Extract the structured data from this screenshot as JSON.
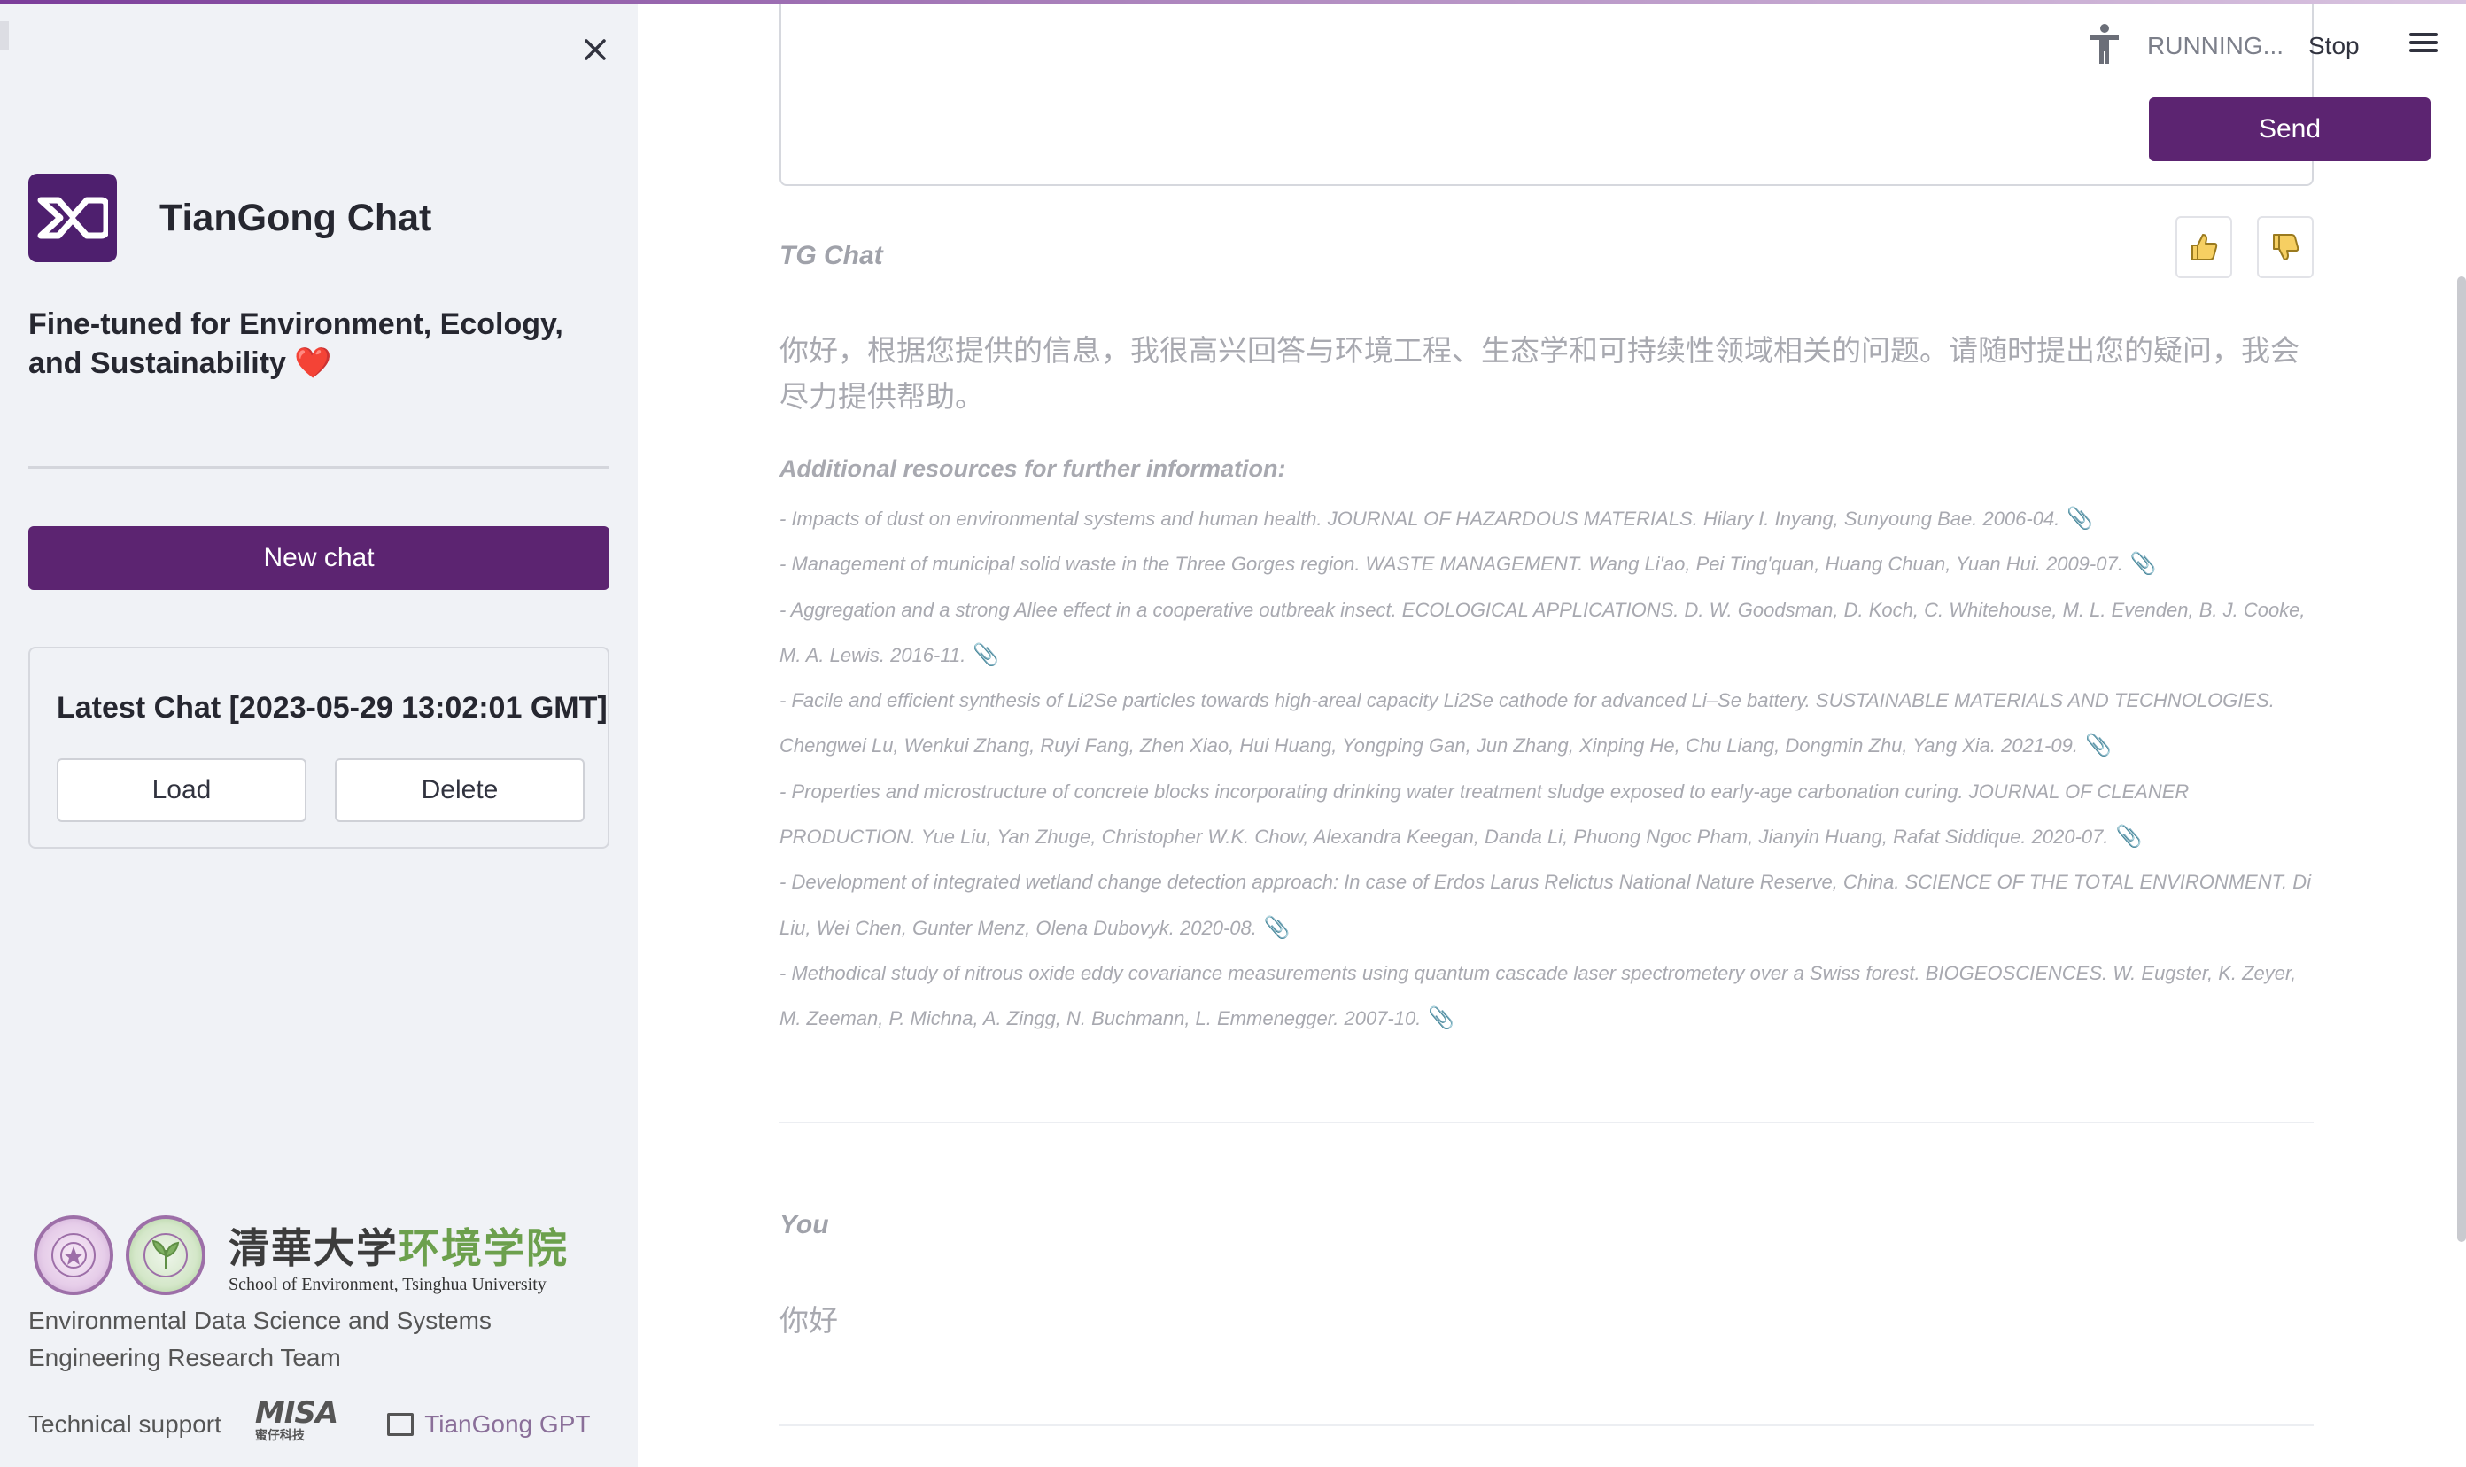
{
  "sidebar": {
    "brand_title": "TianGong Chat",
    "tagline": "Fine-tuned for Environment, Ecology, and Sustainability",
    "tagline_emoji": "❤️",
    "new_chat_label": "New chat",
    "latest_chat": {
      "title": "Latest Chat [2023-05-29 13:02:01 GMT]",
      "load_label": "Load",
      "delete_label": "Delete"
    },
    "school_name_cn_part1": "清華大学",
    "school_name_cn_part2": "环境学院",
    "school_name_en": "School of Environment, Tsinghua University",
    "team_text": "Environmental Data Science and Systems Engineering Research Team",
    "tech_support_label": "Technical support",
    "misa_logo_text": "MISA",
    "misa_logo_subtext": "蜜仔科技",
    "gpt_link_label": "TianGong GPT"
  },
  "header": {
    "status_text": "RUNNING...",
    "stop_label": "Stop"
  },
  "chat": {
    "send_label": "Send",
    "assistant_name": "TG Chat",
    "assistant_message": "你好，根据您提供的信息，我很高兴回答与环境工程、生态学和可持续性领域相关的问题。请随时提出您的疑问，我会尽力提供帮助。",
    "resources_title": "Additional resources for further information:",
    "resources": [
      "- Impacts of dust on environmental systems and human health. JOURNAL OF HAZARDOUS MATERIALS. Hilary I. Inyang, Sunyoung Bae. 2006-04.",
      "- Management of municipal solid waste in the Three Gorges region. WASTE MANAGEMENT. Wang Li'ao, Pei Ting'quan, Huang Chuan, Yuan Hui. 2009-07.",
      "- Aggregation and a strong Allee effect in a cooperative outbreak insect. ECOLOGICAL APPLICATIONS. D. W. Goodsman, D. Koch, C. Whitehouse, M. L. Evenden, B. J. Cooke, M. A. Lewis. 2016-11.",
      "- Facile and efficient synthesis of Li2Se particles towards high-areal capacity Li2Se cathode for advanced Li–Se battery. SUSTAINABLE MATERIALS AND TECHNOLOGIES. Chengwei Lu, Wenkui Zhang, Ruyi Fang, Zhen Xiao, Hui Huang, Yongping Gan, Jun Zhang, Xinping He, Chu Liang, Dongmin Zhu, Yang Xia. 2021-09.",
      "- Properties and microstructure of concrete blocks incorporating drinking water treatment sludge exposed to early-age carbonation curing. JOURNAL OF CLEANER PRODUCTION. Yue Liu, Yan Zhuge, Christopher W.K. Chow, Alexandra Keegan, Danda Li, Phuong Ngoc Pham, Jianyin Huang, Rafat Siddique. 2020-07.",
      "- Development of integrated wetland change detection approach: In case of Erdos Larus Relictus National Nature Reserve, China. SCIENCE OF THE TOTAL ENVIRONMENT. Di Liu, Wei Chen, Gunter Menz, Olena Dubovyk. 2020-08.",
      "- Methodical study of nitrous oxide eddy covariance measurements using quantum cascade laser spectrometery over a Swiss forest. BIOGEOSCIENCES. W. Eugster, K. Zeyer, M. Zeeman, P. Michna, A. Zingg, N. Buchmann, L. Emmenegger. 2007-10."
    ],
    "user_name": "You",
    "user_message": "你好"
  },
  "colors": {
    "accent": "#5c2471",
    "sidebar_bg": "#f0f2f6",
    "muted_text": "#a8a9b0"
  }
}
